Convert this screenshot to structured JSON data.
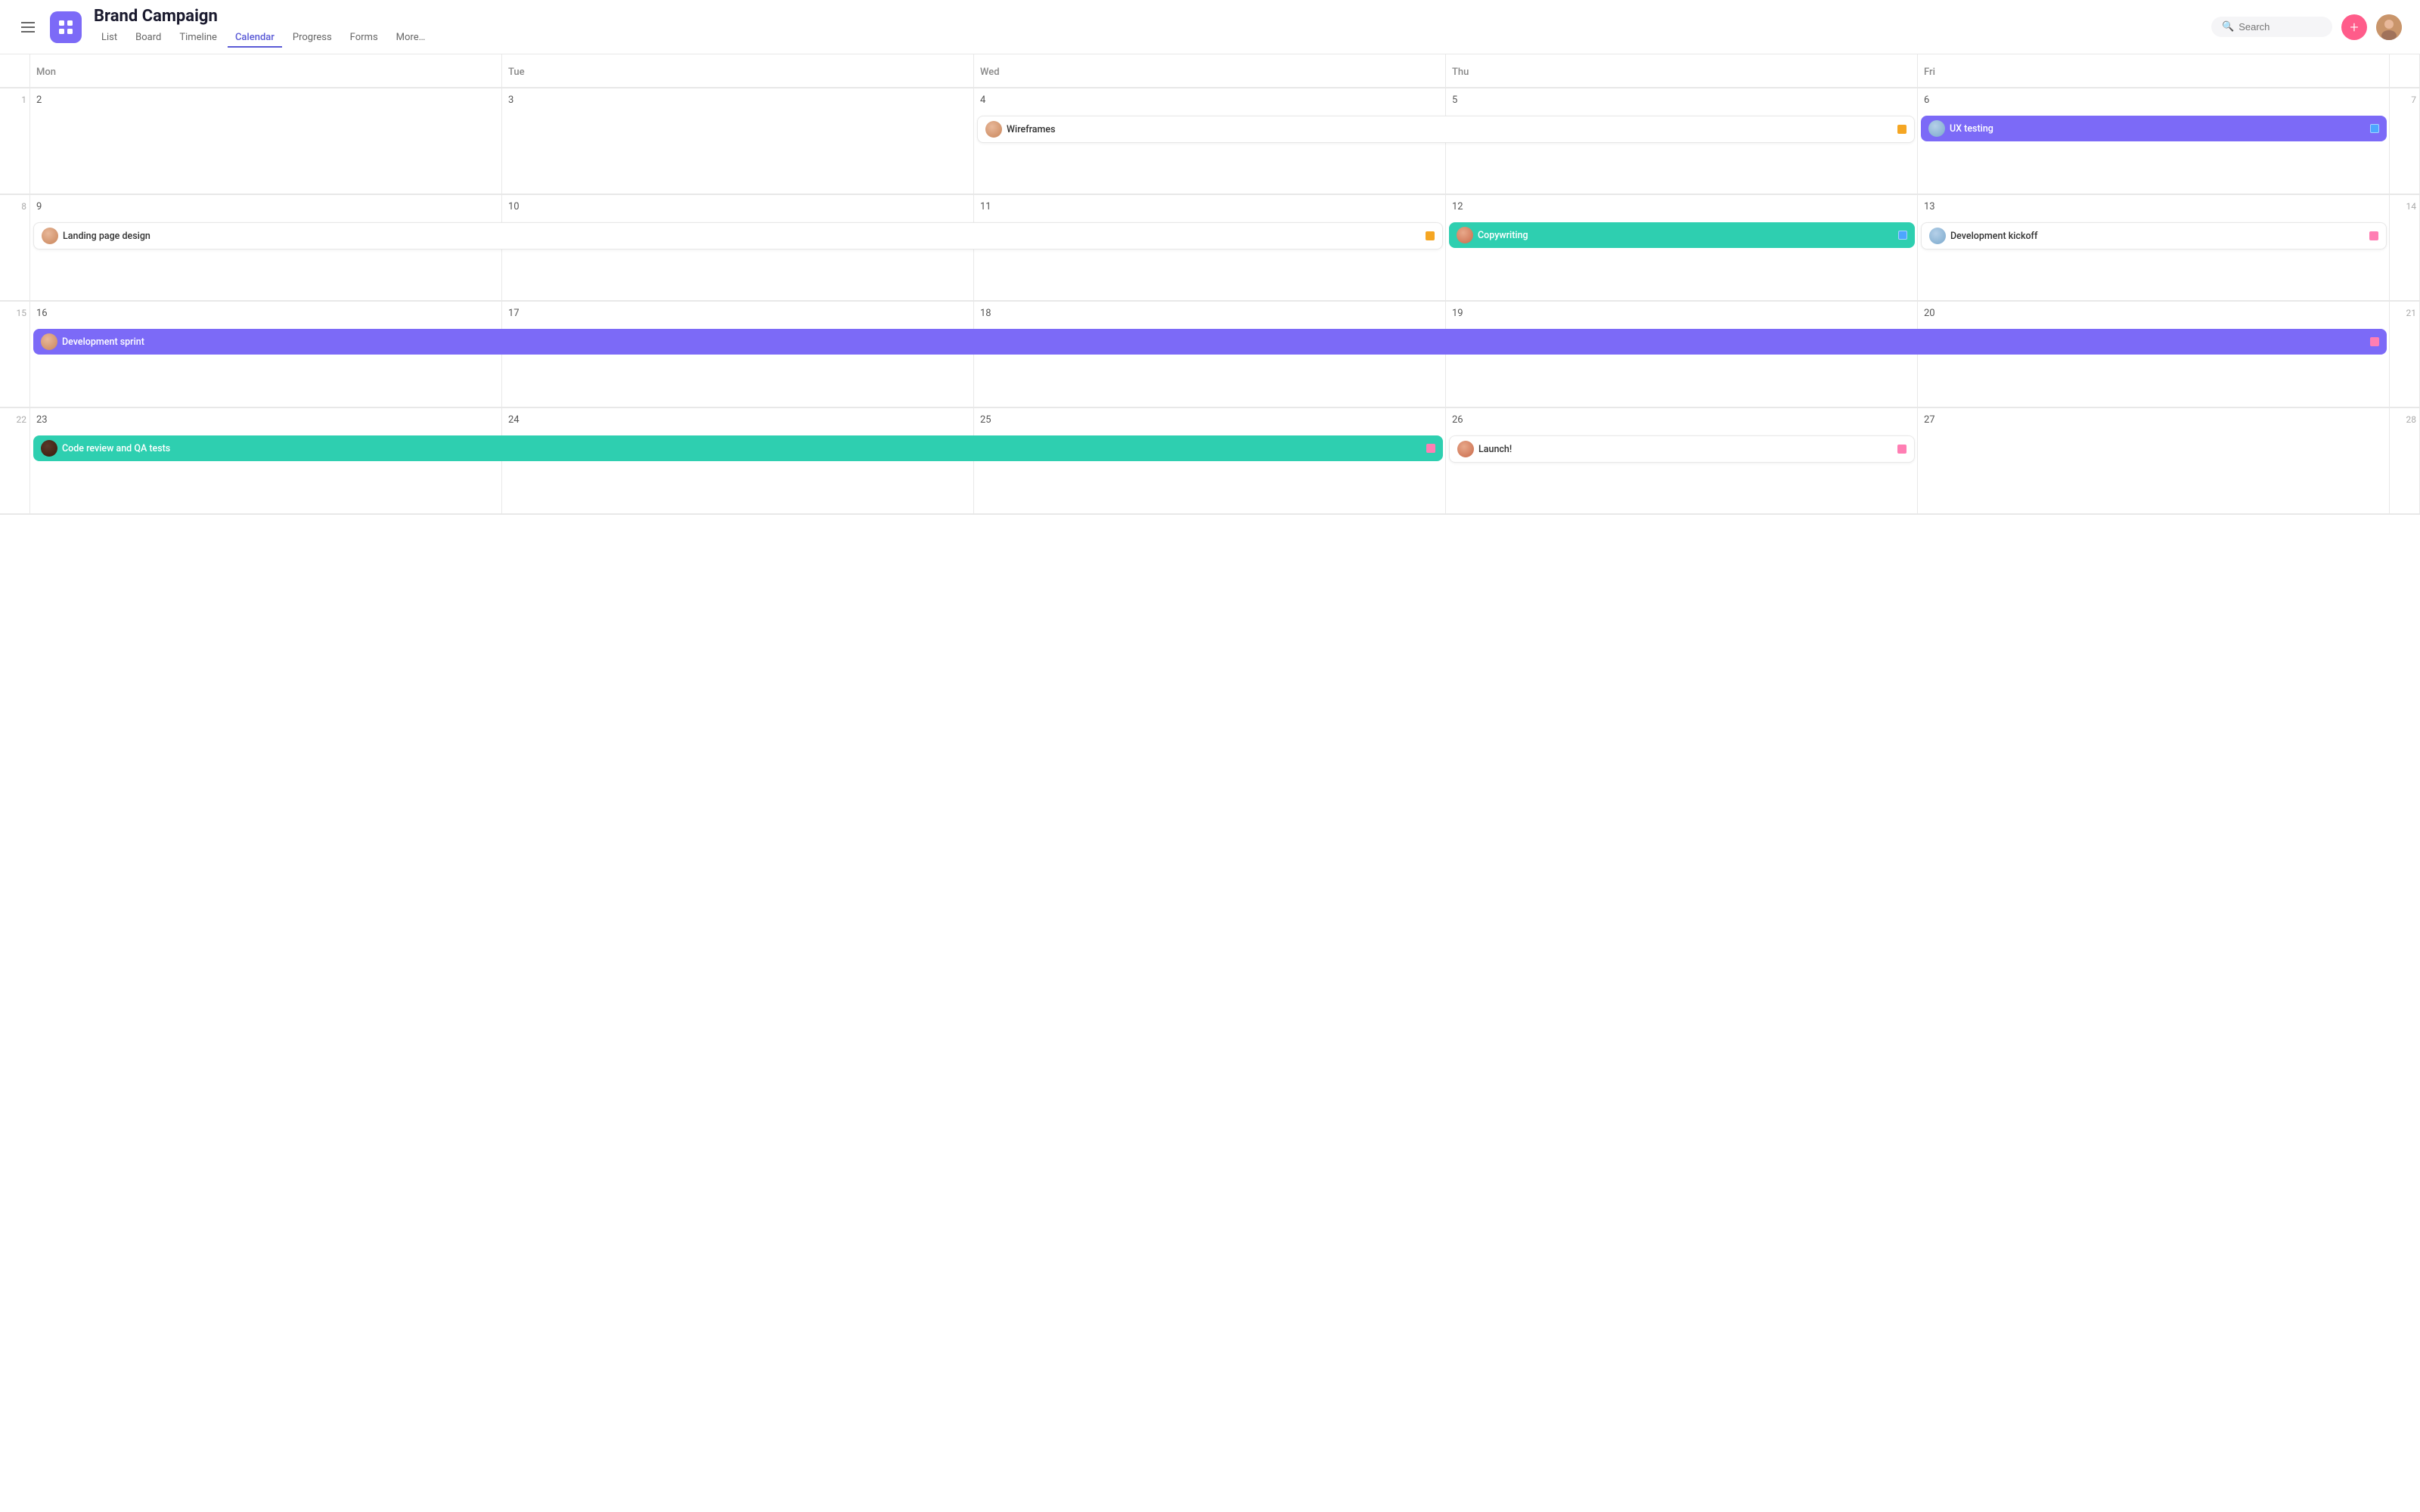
{
  "header": {
    "project_title": "Brand Campaign",
    "nav_tabs": [
      "List",
      "Board",
      "Timeline",
      "Calendar",
      "Progress",
      "Forms",
      "More…"
    ],
    "active_tab": "Calendar",
    "search_placeholder": "Search",
    "add_button_label": "+",
    "app_icon_alt": "App icon"
  },
  "calendar": {
    "day_headers": [
      "",
      "Mon",
      "Tue",
      "Wed",
      "Thu",
      "Fri",
      ""
    ],
    "weeks": [
      {
        "week_num": "1",
        "days": [
          {
            "num": "2",
            "events": []
          },
          {
            "num": "3",
            "events": []
          },
          {
            "num": "4",
            "events": [
              {
                "id": "wireframes",
                "label": "Wireframes",
                "type": "white",
                "dot": "orange",
                "face": "face-1",
                "span": 2
              }
            ]
          },
          {
            "num": "5",
            "events": []
          },
          {
            "num": "6",
            "events": [
              {
                "id": "ux-testing",
                "label": "UX testing",
                "type": "purple",
                "dot": "blue",
                "face": "face-2"
              }
            ]
          }
        ],
        "week_end": "7",
        "spanning": []
      },
      {
        "week_num": "8",
        "days": [
          {
            "num": "9",
            "events": [
              {
                "id": "landing-page",
                "label": "Landing page design",
                "type": "white",
                "dot": "orange",
                "face": "face-1",
                "span": 3
              }
            ]
          },
          {
            "num": "10",
            "events": []
          },
          {
            "num": "11",
            "events": []
          },
          {
            "num": "12",
            "events": [
              {
                "id": "copywriting",
                "label": "Copywriting",
                "type": "teal",
                "dot": "blue",
                "face": "face-3"
              }
            ]
          },
          {
            "num": "13",
            "events": [
              {
                "id": "dev-kickoff",
                "label": "Development kickoff",
                "type": "white",
                "dot": "pink",
                "face": "face-2"
              }
            ]
          }
        ],
        "week_end": "14",
        "spanning": []
      },
      {
        "week_num": "15",
        "days": [
          {
            "num": "16",
            "events": []
          },
          {
            "num": "17",
            "events": []
          },
          {
            "num": "18",
            "events": []
          },
          {
            "num": "19",
            "events": []
          },
          {
            "num": "20",
            "events": []
          }
        ],
        "week_end": "21",
        "spanning": [
          {
            "id": "dev-sprint",
            "label": "Development sprint",
            "type": "purple",
            "dot": "pink",
            "face": "face-1",
            "col_start": 1,
            "col_span": 5
          }
        ]
      },
      {
        "week_num": "22",
        "days": [
          {
            "num": "23",
            "events": []
          },
          {
            "num": "24",
            "events": []
          },
          {
            "num": "25",
            "events": []
          },
          {
            "num": "26",
            "events": [
              {
                "id": "launch",
                "label": "Launch!",
                "type": "white",
                "dot": "pink",
                "face": "face-3"
              }
            ]
          },
          {
            "num": "27",
            "events": []
          }
        ],
        "week_end": "28",
        "spanning": [
          {
            "id": "code-review",
            "label": "Code review and QA tests",
            "type": "teal",
            "dot": "pink",
            "face": "face-4",
            "col_start": 1,
            "col_span": 3
          }
        ]
      }
    ]
  }
}
